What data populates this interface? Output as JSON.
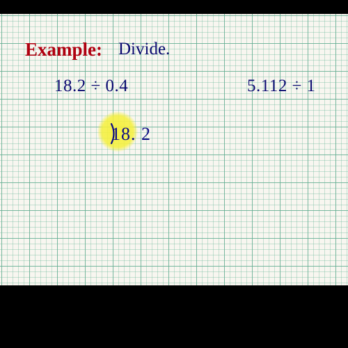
{
  "header": {
    "example_label": "Example:",
    "instruction": "Divide."
  },
  "problems": {
    "p1": "18.2 ÷ 0.4",
    "p2": "5.112 ÷ 1"
  },
  "handwritten": {
    "dividend": "18. 2"
  },
  "colors": {
    "red": "#b00010",
    "blue": "#0a0a70",
    "highlight": "#f5f03c",
    "grid": "#6cae95"
  }
}
